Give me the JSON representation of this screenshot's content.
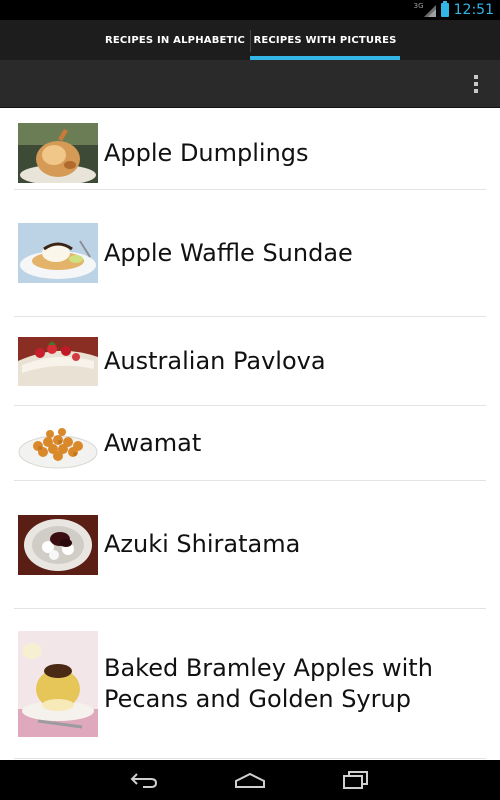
{
  "status_bar": {
    "network": "3G",
    "time": "12:51"
  },
  "tabs": [
    {
      "label": "RECIPES IN ALPHABETIC",
      "selected": false
    },
    {
      "label": "RECIPES WITH PICTURES",
      "selected": true
    }
  ],
  "action_bar": {
    "overflow_icon": "overflow-menu-icon"
  },
  "recipes": [
    {
      "name": "Apple Dumplings",
      "thumbnail": "apple-dumplings-photo"
    },
    {
      "name": "Apple Waffle Sundae",
      "thumbnail": "apple-waffle-sundae-photo"
    },
    {
      "name": "Australian Pavlova",
      "thumbnail": "australian-pavlova-photo"
    },
    {
      "name": "Awamat",
      "thumbnail": "awamat-photo"
    },
    {
      "name": "Azuki Shiratama",
      "thumbnail": "azuki-shiratama-photo"
    },
    {
      "name": "Baked Bramley Apples with Pecans and Golden Syrup",
      "thumbnail": "baked-bramley-apples-photo"
    }
  ],
  "nav_bar": {
    "icons": [
      "back-icon",
      "home-icon",
      "recent-apps-icon"
    ]
  },
  "colors": {
    "accent": "#33b5e5",
    "tab_bar": "#1d1d1d",
    "action_bar": "#2a2a2a"
  }
}
